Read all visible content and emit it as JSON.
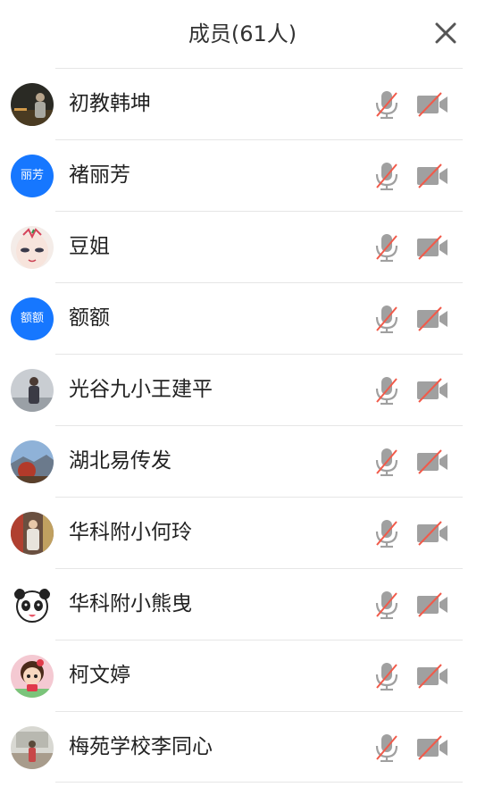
{
  "header": {
    "title": "成员(61人)",
    "close_icon": "close-icon"
  },
  "colors": {
    "accent": "#1677ff",
    "muted_icon": "#9a9a9a",
    "slash": "#f15a4a"
  },
  "members": [
    {
      "name": "初教韩坤",
      "avatar_text": "",
      "mic": "mic-muted-icon",
      "camera": "camera-off-icon"
    },
    {
      "name": "褚丽芳",
      "avatar_text": "丽芳",
      "mic": "mic-muted-icon",
      "camera": "camera-off-icon"
    },
    {
      "name": "豆姐",
      "avatar_text": "",
      "mic": "mic-muted-icon",
      "camera": "camera-off-icon"
    },
    {
      "name": "额额",
      "avatar_text": "额额",
      "mic": "mic-muted-icon",
      "camera": "camera-off-icon"
    },
    {
      "name": "光谷九小王建平",
      "avatar_text": "",
      "mic": "mic-muted-icon",
      "camera": "camera-off-icon"
    },
    {
      "name": "湖北易传发",
      "avatar_text": "",
      "mic": "mic-muted-icon",
      "camera": "camera-off-icon"
    },
    {
      "name": "华科附小何玲",
      "avatar_text": "",
      "mic": "mic-muted-icon",
      "camera": "camera-off-icon"
    },
    {
      "name": "华科附小熊曳",
      "avatar_text": "",
      "mic": "mic-muted-icon",
      "camera": "camera-off-icon"
    },
    {
      "name": "柯文婷",
      "avatar_text": "",
      "mic": "mic-muted-icon",
      "camera": "camera-off-icon"
    },
    {
      "name": "梅苑学校李同心",
      "avatar_text": "",
      "mic": "mic-muted-icon",
      "camera": "camera-off-icon"
    }
  ]
}
